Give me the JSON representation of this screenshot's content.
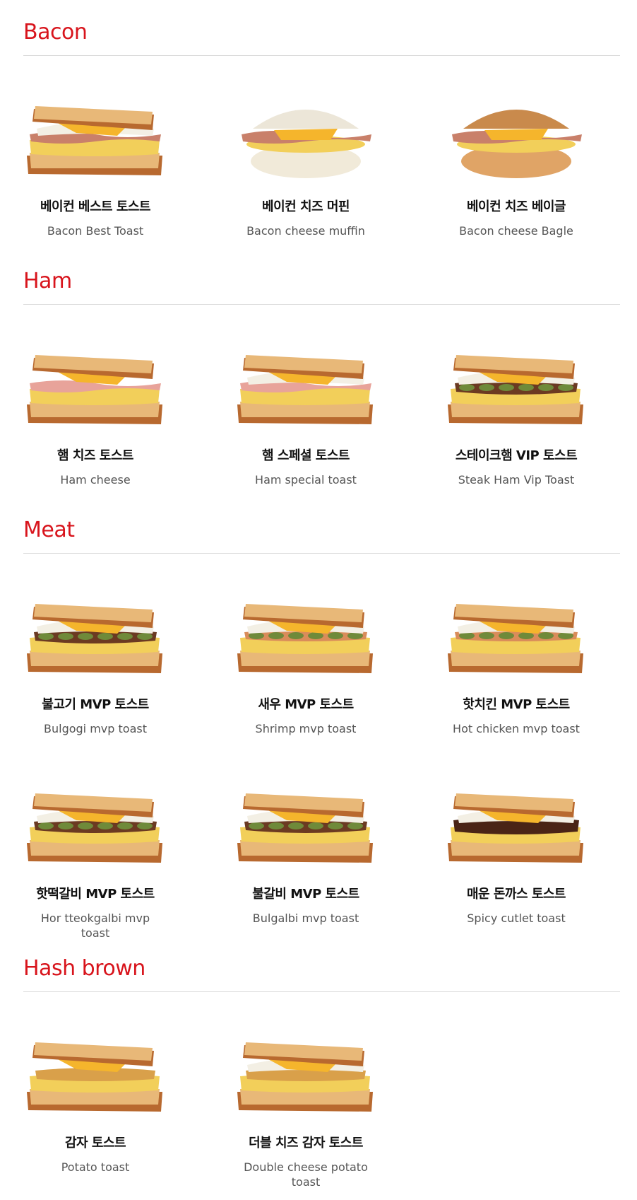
{
  "sections": [
    {
      "title": "Bacon",
      "items": [
        {
          "ko": "베이컨 베스트 토스트",
          "en": "Bacon Best Toast",
          "kind": "toast",
          "filling": "bacon"
        },
        {
          "ko": "베이컨 치즈 머핀",
          "en": "Bacon cheese muffin",
          "kind": "muffin",
          "filling": "bacon"
        },
        {
          "ko": "베이컨 치즈 베이글",
          "en": "Bacon cheese Bagle",
          "kind": "bagel",
          "filling": "bacon"
        }
      ]
    },
    {
      "title": "Ham",
      "items": [
        {
          "ko": "햄 치즈 토스트",
          "en": "Ham cheese",
          "kind": "toast",
          "filling": "ham"
        },
        {
          "ko": "햄 스페셜 토스트",
          "en": "Ham special toast",
          "kind": "toast",
          "filling": "ham-special"
        },
        {
          "ko": "스테이크햄 VIP 토스트",
          "en": "Steak Ham Vip Toast",
          "kind": "toast",
          "filling": "steak"
        }
      ]
    },
    {
      "title": "Meat",
      "items": [
        {
          "ko": "불고기 MVP 토스트",
          "en": "Bulgogi mvp toast",
          "kind": "toast",
          "filling": "bulgogi"
        },
        {
          "ko": "새우 MVP 토스트",
          "en": "Shrimp mvp toast",
          "kind": "toast",
          "filling": "shrimp"
        },
        {
          "ko": "핫치킨 MVP 토스트",
          "en": "Hot chicken mvp toast",
          "kind": "toast",
          "filling": "chicken"
        },
        {
          "ko": "핫떡갈비 MVP 토스트",
          "en": "Hor tteokgalbi mvp toast",
          "kind": "toast",
          "filling": "tteokgalbi"
        },
        {
          "ko": "불갈비 MVP 토스트",
          "en": "Bulgalbi mvp toast",
          "kind": "toast",
          "filling": "bulgalbi"
        },
        {
          "ko": "매운 돈까스 토스트",
          "en": "Spicy cutlet toast",
          "kind": "toast",
          "filling": "cutlet"
        }
      ]
    },
    {
      "title": "Hash brown",
      "items": [
        {
          "ko": "감자 토스트",
          "en": "Potato toast",
          "kind": "toast",
          "filling": "potato"
        },
        {
          "ko": "더블 치즈 감자 토스트",
          "en": "Double cheese potato toast",
          "kind": "toast",
          "filling": "potato-cheese"
        }
      ]
    }
  ],
  "colors": {
    "accent": "#d8141c",
    "bread": "#e8b878",
    "crust": "#b8692f",
    "egg": "#f2cf5a",
    "cheese": "#f5b52c",
    "cabbage": "#f3efe4"
  }
}
